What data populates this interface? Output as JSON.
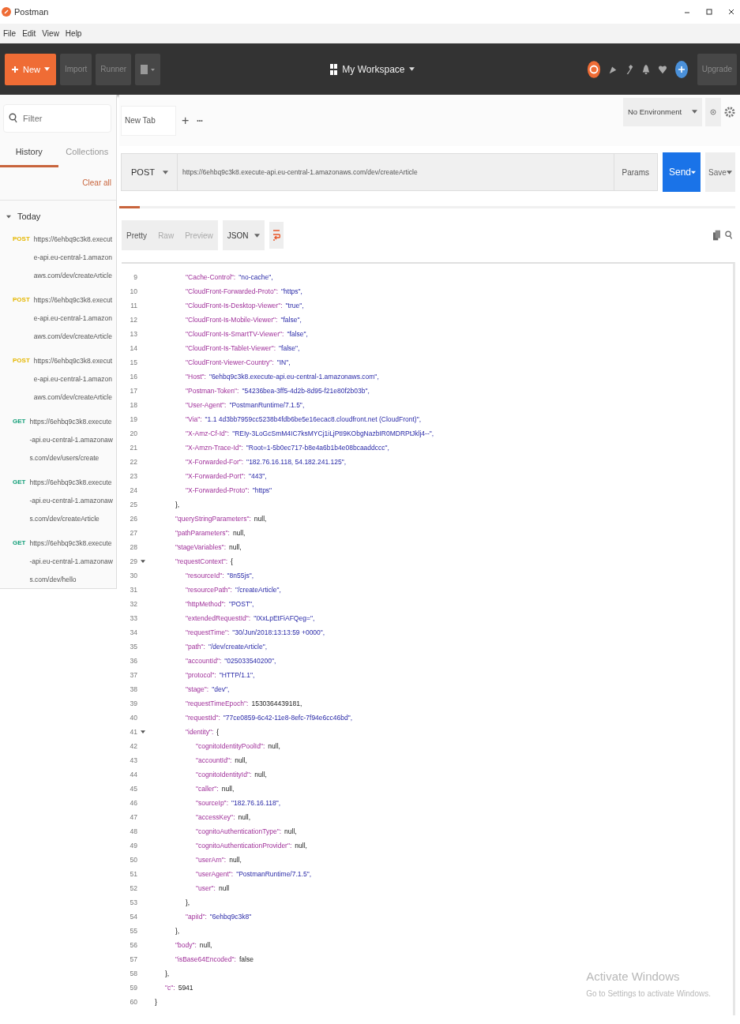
{
  "window": {
    "title": "Postman"
  },
  "menu": [
    "File",
    "Edit",
    "View",
    "Help"
  ],
  "toolbar": {
    "new_label": "New",
    "buttons": [
      "Import",
      "Runner"
    ],
    "workspace": "My Workspace",
    "upgrade": "Upgrade"
  },
  "sidebar": {
    "filter_placeholder": "Filter",
    "tabs": [
      {
        "label": "History",
        "selected": true
      },
      {
        "label": "Collections",
        "selected": false
      }
    ],
    "clear": "Clear all",
    "group": {
      "label": "Today",
      "expanded": true
    },
    "items": [
      {
        "method": "POST",
        "color": "#e5b700",
        "url": "https://6ehbq9c3k8.execute-api.eu-central-1.amazonaws.com/dev/createArticle"
      },
      {
        "method": "POST",
        "color": "#e5b700",
        "url": "https://6ehbq9c3k8.execute-api.eu-central-1.amazonaws.com/dev/createArticle"
      },
      {
        "method": "POST",
        "color": "#e5b700",
        "url": "https://6ehbq9c3k8.execute-api.eu-central-1.amazonaws.com/dev/createArticle"
      },
      {
        "method": "GET",
        "color": "#16a07a",
        "url": "https://6ehbq9c3k8.execute-api.eu-central-1.amazonaws.com/dev/users/create"
      },
      {
        "method": "GET",
        "color": "#16a07a",
        "url": "https://6ehbq9c3k8.execute-api.eu-central-1.amazonaws.com/dev/createArticle"
      },
      {
        "method": "GET",
        "color": "#16a07a",
        "url": "https://6ehbq9c3k8.execute-api.eu-central-1.amazonaws.com/dev/hello"
      }
    ]
  },
  "request_tab": {
    "label": "New Tab",
    "add": "+",
    "more": "•••"
  },
  "environment": {
    "value": "No Environment"
  },
  "request": {
    "method": "POST",
    "url": "https://6ehbq9c3k8.execute-api.eu-central-1.amazonaws.com/dev/createArticle",
    "params": "Params",
    "send": "Send",
    "save": "Save"
  },
  "response": {
    "views": [
      {
        "label": "Pretty",
        "selected": true
      },
      {
        "label": "Raw",
        "selected": false
      },
      {
        "label": "Preview",
        "selected": false
      }
    ],
    "format": "JSON",
    "lines": [
      {
        "children": [
          {
            "children": [
              {
                "children": [
                  {
                    "n": "9",
                    "tokens": [
                      {
                        "t": "\"Cache-Control\":",
                        "kind": "key"
                      },
                      {
                        "t": "\"no-cache\",",
                        "kind": "string"
                      }
                    ]
                  },
                  {
                    "n": "10",
                    "tokens": [
                      {
                        "t": "\"CloudFront-Forwarded-Proto\":",
                        "kind": "key"
                      },
                      {
                        "t": "\"https\",",
                        "kind": "string"
                      }
                    ]
                  },
                  {
                    "n": "11",
                    "tokens": [
                      {
                        "t": "\"CloudFront-Is-Desktop-Viewer\":",
                        "kind": "key"
                      },
                      {
                        "t": "\"true\",",
                        "kind": "string"
                      }
                    ]
                  },
                  {
                    "n": "12",
                    "tokens": [
                      {
                        "t": "\"CloudFront-Is-Mobile-Viewer\":",
                        "kind": "key"
                      },
                      {
                        "t": "\"false\",",
                        "kind": "string"
                      }
                    ]
                  },
                  {
                    "n": "13",
                    "tokens": [
                      {
                        "t": "\"CloudFront-Is-SmartTV-Viewer\":",
                        "kind": "key"
                      },
                      {
                        "t": "\"false\",",
                        "kind": "string"
                      }
                    ]
                  },
                  {
                    "n": "14",
                    "tokens": [
                      {
                        "t": "\"CloudFront-Is-Tablet-Viewer\":",
                        "kind": "key"
                      },
                      {
                        "t": "\"false\",",
                        "kind": "string"
                      }
                    ]
                  },
                  {
                    "n": "15",
                    "tokens": [
                      {
                        "t": "\"CloudFront-Viewer-Country\":",
                        "kind": "key"
                      },
                      {
                        "t": "\"IN\",",
                        "kind": "string"
                      }
                    ]
                  },
                  {
                    "n": "16",
                    "tokens": [
                      {
                        "t": "\"Host\":",
                        "kind": "key"
                      },
                      {
                        "t": "\"6ehbq9c3k8.execute-api.eu-central-1.amazonaws.com\",",
                        "kind": "string"
                      }
                    ]
                  },
                  {
                    "n": "17",
                    "tokens": [
                      {
                        "t": "\"Postman-Token\":",
                        "kind": "key"
                      },
                      {
                        "t": "\"54236bea-3ff5-4d2b-8d95-f21e80f2b03b\",",
                        "kind": "string"
                      }
                    ]
                  },
                  {
                    "n": "18",
                    "tokens": [
                      {
                        "t": "\"User-Agent\":",
                        "kind": "key"
                      },
                      {
                        "t": "\"PostmanRuntime/7.1.5\",",
                        "kind": "string"
                      }
                    ]
                  },
                  {
                    "n": "19",
                    "tokens": [
                      {
                        "t": "\"Via\":",
                        "kind": "key"
                      },
                      {
                        "t": "\"1.1 4d3bb7959cc5238b4fdb6be5e16ecac8.cloudfront.net (CloudFront)\",",
                        "kind": "string"
                      }
                    ]
                  },
                  {
                    "n": "20",
                    "tokens": [
                      {
                        "t": "\"X-Amz-Cf-Id\":",
                        "kind": "key"
                      },
                      {
                        "t": "\"REIy-3LoGcSmM4IC7ksMYCj1iLjPtI9KObgNazbIR0MDRPtJklj4--\",",
                        "kind": "string"
                      }
                    ]
                  },
                  {
                    "n": "21",
                    "tokens": [
                      {
                        "t": "\"X-Amzn-Trace-Id\":",
                        "kind": "key"
                      },
                      {
                        "t": "\"Root=1-5b0ec717-b8e4a6b1b4e08bcaaddccc\",",
                        "kind": "string"
                      }
                    ]
                  },
                  {
                    "n": "22",
                    "tokens": [
                      {
                        "t": "\"X-Forwarded-For\":",
                        "kind": "key"
                      },
                      {
                        "t": "\"182.76.16.118, 54.182.241.125\",",
                        "kind": "string"
                      }
                    ]
                  },
                  {
                    "n": "23",
                    "tokens": [
                      {
                        "t": "\"X-Forwarded-Port\":",
                        "kind": "key"
                      },
                      {
                        "t": "\"443\",",
                        "kind": "string"
                      }
                    ]
                  },
                  {
                    "n": "24",
                    "tokens": [
                      {
                        "t": "\"X-Forwarded-Proto\":",
                        "kind": "key"
                      },
                      {
                        "t": "\"https\"",
                        "kind": "string"
                      }
                    ]
                  }
                ]
              },
              {
                "n": "25",
                "tokens": [
                  {
                    "t": "},",
                    "kind": "punct"
                  }
                ]
              },
              {
                "n": "26",
                "tokens": [
                  {
                    "t": "\"queryStringParameters\":",
                    "kind": "key"
                  },
                  {
                    "t": "null,",
                    "kind": "literal"
                  }
                ]
              },
              {
                "n": "27",
                "tokens": [
                  {
                    "t": "\"pathParameters\":",
                    "kind": "key"
                  },
                  {
                    "t": "null,",
                    "kind": "literal"
                  }
                ]
              },
              {
                "n": "28",
                "tokens": [
                  {
                    "t": "\"stageVariables\":",
                    "kind": "key"
                  },
                  {
                    "t": "null,",
                    "kind": "literal"
                  }
                ]
              },
              {
                "n": "29",
                "expanded": true,
                "tokens": [
                  {
                    "t": "\"requestContext\":",
                    "kind": "key"
                  },
                  {
                    "t": "{",
                    "kind": "punct"
                  }
                ],
                "children": [
                  {
                    "n": "30",
                    "tokens": [
                      {
                        "t": "\"resourceId\":",
                        "kind": "key"
                      },
                      {
                        "t": "\"8n55js\",",
                        "kind": "string"
                      }
                    ]
                  },
                  {
                    "n": "31",
                    "tokens": [
                      {
                        "t": "\"resourcePath\":",
                        "kind": "key"
                      },
                      {
                        "t": "\"/createArticle\",",
                        "kind": "string"
                      }
                    ]
                  },
                  {
                    "n": "32",
                    "tokens": [
                      {
                        "t": "\"httpMethod\":",
                        "kind": "key"
                      },
                      {
                        "t": "\"POST\",",
                        "kind": "string"
                      }
                    ]
                  },
                  {
                    "n": "33",
                    "tokens": [
                      {
                        "t": "\"extendedRequestId\":",
                        "kind": "key"
                      },
                      {
                        "t": "\"IXxLpEtFiAFQeg=\",",
                        "kind": "string"
                      }
                    ]
                  },
                  {
                    "n": "34",
                    "tokens": [
                      {
                        "t": "\"requestTime\":",
                        "kind": "key"
                      },
                      {
                        "t": "\"30/Jun/2018:13:13:59 +0000\",",
                        "kind": "string"
                      }
                    ]
                  },
                  {
                    "n": "35",
                    "tokens": [
                      {
                        "t": "\"path\":",
                        "kind": "key"
                      },
                      {
                        "t": "\"/dev/createArticle\",",
                        "kind": "string"
                      }
                    ]
                  },
                  {
                    "n": "36",
                    "tokens": [
                      {
                        "t": "\"accountId\":",
                        "kind": "key"
                      },
                      {
                        "t": "\"025033540200\",",
                        "kind": "string"
                      }
                    ]
                  },
                  {
                    "n": "37",
                    "tokens": [
                      {
                        "t": "\"protocol\":",
                        "kind": "key"
                      },
                      {
                        "t": "\"HTTP/1.1\",",
                        "kind": "string"
                      }
                    ]
                  },
                  {
                    "n": "38",
                    "tokens": [
                      {
                        "t": "\"stage\":",
                        "kind": "key"
                      },
                      {
                        "t": "\"dev\",",
                        "kind": "string"
                      }
                    ]
                  },
                  {
                    "n": "39",
                    "tokens": [
                      {
                        "t": "\"requestTimeEpoch\":",
                        "kind": "key"
                      },
                      {
                        "t": "1530364439181,",
                        "kind": "literal"
                      }
                    ]
                  },
                  {
                    "n": "40",
                    "tokens": [
                      {
                        "t": "\"requestId\":",
                        "kind": "key"
                      },
                      {
                        "t": "\"77ce0859-6c42-11e8-8efc-7f94e6cc46bd\",",
                        "kind": "string"
                      }
                    ]
                  },
                  {
                    "n": "41",
                    "expanded": true,
                    "tokens": [
                      {
                        "t": "\"identity\":",
                        "kind": "key"
                      },
                      {
                        "t": "{",
                        "kind": "punct"
                      }
                    ],
                    "children": [
                      {
                        "n": "42",
                        "tokens": [
                          {
                            "t": "\"cognitoIdentityPoolId\":",
                            "kind": "key"
                          },
                          {
                            "t": "null,",
                            "kind": "literal"
                          }
                        ]
                      },
                      {
                        "n": "43",
                        "tokens": [
                          {
                            "t": "\"accountId\":",
                            "kind": "key"
                          },
                          {
                            "t": "null,",
                            "kind": "literal"
                          }
                        ]
                      },
                      {
                        "n": "44",
                        "tokens": [
                          {
                            "t": "\"cognitoIdentityId\":",
                            "kind": "key"
                          },
                          {
                            "t": "null,",
                            "kind": "literal"
                          }
                        ]
                      },
                      {
                        "n": "45",
                        "tokens": [
                          {
                            "t": "\"caller\":",
                            "kind": "key"
                          },
                          {
                            "t": "null,",
                            "kind": "literal"
                          }
                        ]
                      },
                      {
                        "n": "46",
                        "tokens": [
                          {
                            "t": "\"sourceIp\":",
                            "kind": "key"
                          },
                          {
                            "t": "\"182.76.16.118\",",
                            "kind": "string"
                          }
                        ]
                      },
                      {
                        "n": "47",
                        "tokens": [
                          {
                            "t": "\"accessKey\":",
                            "kind": "key"
                          },
                          {
                            "t": "null,",
                            "kind": "literal"
                          }
                        ]
                      },
                      {
                        "n": "48",
                        "tokens": [
                          {
                            "t": "\"cognitoAuthenticationType\":",
                            "kind": "key"
                          },
                          {
                            "t": "null,",
                            "kind": "literal"
                          }
                        ]
                      },
                      {
                        "n": "49",
                        "tokens": [
                          {
                            "t": "\"cognitoAuthenticationProvider\":",
                            "kind": "key"
                          },
                          {
                            "t": "null,",
                            "kind": "literal"
                          }
                        ]
                      },
                      {
                        "n": "50",
                        "tokens": [
                          {
                            "t": "\"userArn\":",
                            "kind": "key"
                          },
                          {
                            "t": "null,",
                            "kind": "literal"
                          }
                        ]
                      },
                      {
                        "n": "51",
                        "tokens": [
                          {
                            "t": "\"userAgent\":",
                            "kind": "key"
                          },
                          {
                            "t": "\"PostmanRuntime/7.1.5\",",
                            "kind": "string"
                          }
                        ]
                      },
                      {
                        "n": "52",
                        "tokens": [
                          {
                            "t": "\"user\":",
                            "kind": "key"
                          },
                          {
                            "t": "null",
                            "kind": "literal"
                          }
                        ]
                      }
                    ]
                  },
                  {
                    "n": "53",
                    "tokens": [
                      {
                        "t": "},",
                        "kind": "punct"
                      }
                    ]
                  },
                  {
                    "n": "54",
                    "tokens": [
                      {
                        "t": "\"apiId\":",
                        "kind": "key"
                      },
                      {
                        "t": "\"6ehbq9c3k8\"",
                        "kind": "string"
                      }
                    ]
                  }
                ]
              },
              {
                "n": "55",
                "tokens": [
                  {
                    "t": "},",
                    "kind": "punct"
                  }
                ]
              },
              {
                "n": "56",
                "tokens": [
                  {
                    "t": "\"body\":",
                    "kind": "key"
                  },
                  {
                    "t": "null,",
                    "kind": "literal"
                  }
                ]
              },
              {
                "n": "57",
                "tokens": [
                  {
                    "t": "\"isBase64Encoded\":",
                    "kind": "key"
                  },
                  {
                    "t": "false",
                    "kind": "literal"
                  }
                ]
              }
            ]
          },
          {
            "n": "58",
            "tokens": [
              {
                "t": "},",
                "kind": "punct"
              }
            ]
          },
          {
            "n": "59",
            "tokens": [
              {
                "t": "\"c\":",
                "kind": "key"
              },
              {
                "t": "5941",
                "kind": "literal"
              }
            ]
          }
        ]
      },
      {
        "n": "60",
        "tokens": [
          {
            "t": "}",
            "kind": "punct"
          }
        ]
      }
    ]
  },
  "os_notice": {
    "title": "Activate Windows",
    "text": "Go to Settings to activate Windows."
  }
}
